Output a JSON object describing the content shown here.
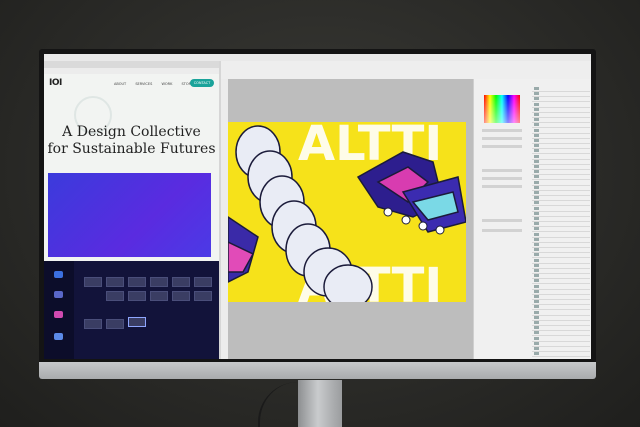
{
  "browser": {
    "logo": "IOI",
    "nav": [
      "ABOUT",
      "SERVICES",
      "WORK",
      "STORIES"
    ],
    "contact": "CONTACT",
    "headline_line1": "A Design Collective",
    "headline_line2": "for Sustainable Futures"
  },
  "photoshop": {
    "canvas_text": "ALTTI"
  },
  "colors": {
    "canvas_yellow": "#f6e21a",
    "accent_teal": "#1aa39a",
    "purple": "#4b3ae6",
    "dark_app": "#12133a"
  }
}
